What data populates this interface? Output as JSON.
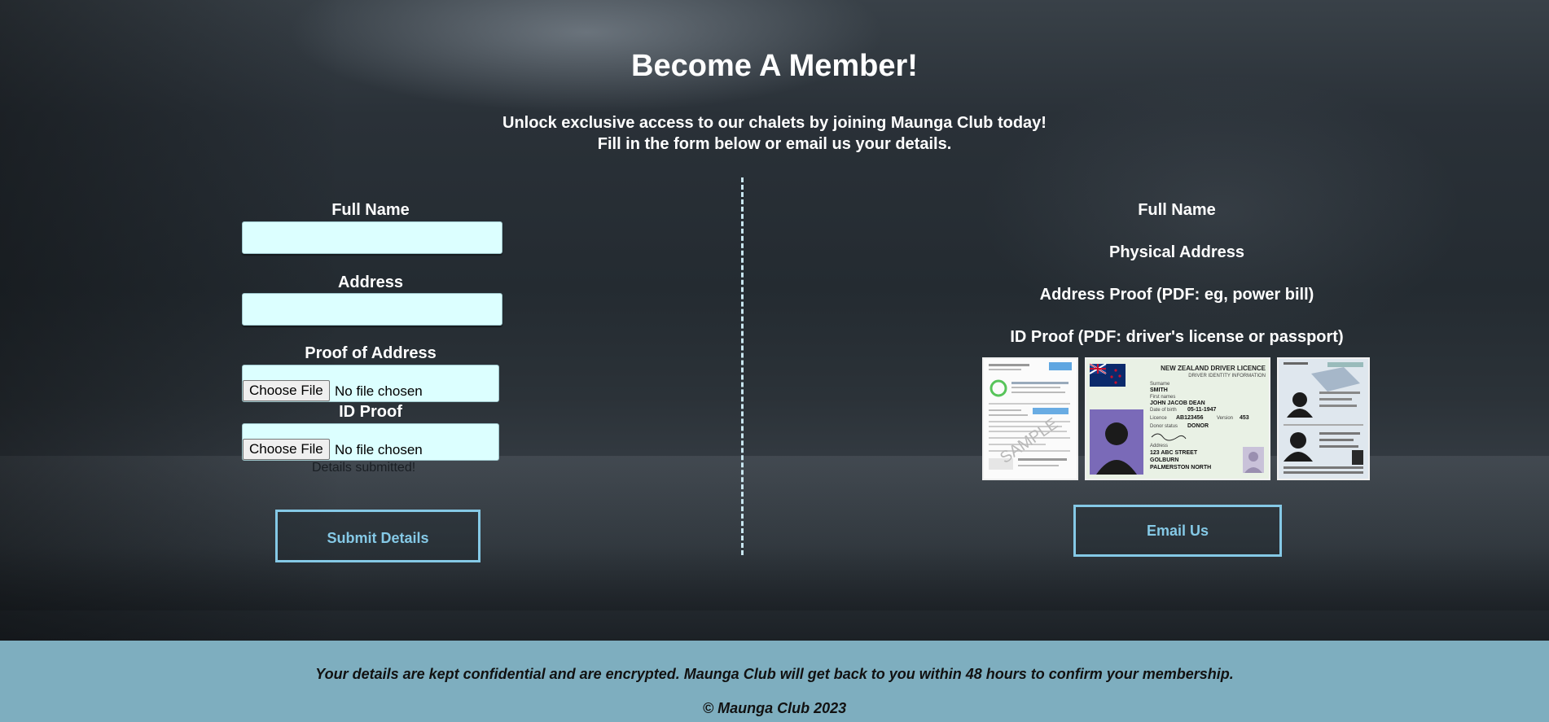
{
  "page": {
    "title": "Become A Member!",
    "subtitle_line1": "Unlock exclusive access to our chalets by joining Maunga Club today!",
    "subtitle_line2": "Fill in the form below or email us your details."
  },
  "form": {
    "full_name_label": "Full Name",
    "full_name_value": "",
    "address_label": "Address",
    "address_value": "",
    "proof_address_label": "Proof of Address",
    "id_proof_label": "ID Proof",
    "file_button_label": "Choose File",
    "file_status": "No file chosen",
    "submitted_note": "Details submitted!",
    "submit_label": "Submit Details"
  },
  "info": {
    "items": [
      "Full Name",
      "Physical Address",
      "Address Proof (PDF: eg, power bill)",
      "ID Proof (PDF: driver's license or passport)"
    ],
    "email_label": "Email Us",
    "license": {
      "heading": "NEW ZEALAND DRIVER LICENCE",
      "subheading": "DRIVER IDENTITY INFORMATION",
      "surname_label": "Surname",
      "surname": "SMITH",
      "first_names_label": "First names",
      "first_names": "JOHN JACOB DEAN",
      "dob_label": "Date of birth",
      "dob": "05-11-1947",
      "licence_label": "Licence",
      "licence_no": "AB123456",
      "version_label": "Version",
      "version": "453",
      "donor_label": "Donor status",
      "donor": "DONOR",
      "address_label": "Address",
      "address1": "123 ABC STREET",
      "address2": "GOLBURN",
      "address3": "PALMERSTON NORTH"
    },
    "bill": {
      "watermark": "SAMPLE"
    }
  },
  "footer": {
    "note": "Your details are kept confidential and are encrypted. Maunga Club will get back to you within 48 hours to confirm your membership.",
    "copyright": "© Maunga Club 2023"
  },
  "colors": {
    "accent": "#85c9e6",
    "input_bg": "#dcffff",
    "footer_bg": "#7eaebf"
  }
}
